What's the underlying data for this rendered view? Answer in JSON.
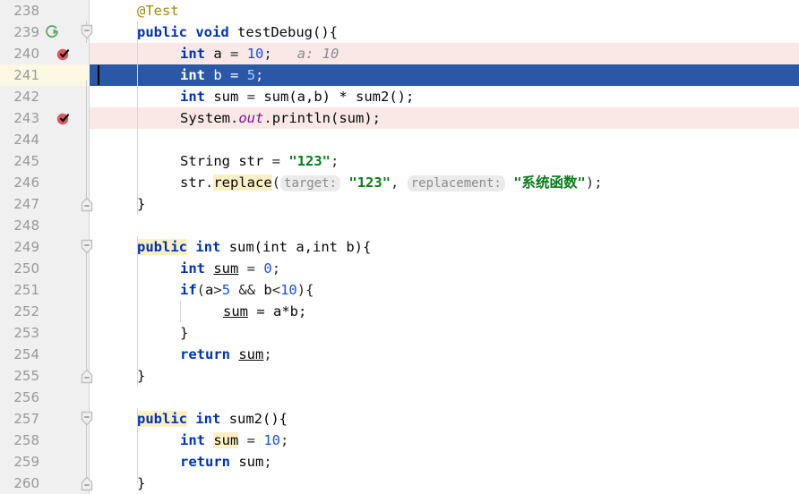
{
  "editor": {
    "app": "intellij-idea-code-editor",
    "language": "java",
    "first_line": 238,
    "last_line": 260,
    "line_height": 24,
    "caret_line": 241,
    "colors": {
      "background": "#ffffff",
      "gutter_background": "#f0f0f0",
      "line_number": "#999999",
      "selection": "#2a58a4",
      "breakpoint_line": "#f9e8e6",
      "caret_line_gutter": "#fcf8e3",
      "keyword": "#0033b3",
      "number": "#1750eb",
      "string": "#067d17",
      "annotation": "#9e880d",
      "static_field": "#871094",
      "identifier_highlight": "#fbefc4",
      "inline_hint": "#8c8c8c",
      "param_hint_background": "#ebebeb",
      "indent_guide": "#d8d8d8",
      "breakpoint_icon": "#db5860",
      "run_icon": "#59a869"
    },
    "gutter": {
      "line_numbers": [
        238,
        239,
        240,
        241,
        242,
        243,
        244,
        245,
        246,
        247,
        248,
        249,
        250,
        251,
        252,
        253,
        254,
        255,
        256,
        257,
        258,
        259,
        260
      ],
      "run_marker_line": 239,
      "breakpoint_lines": [
        240,
        243
      ],
      "fold_markers": [
        {
          "line": 239,
          "type": "fold-open-down"
        },
        {
          "line": 247,
          "type": "fold-close-up"
        },
        {
          "line": 249,
          "type": "fold-open-down"
        },
        {
          "line": 255,
          "type": "fold-close-up"
        },
        {
          "line": 257,
          "type": "fold-open-down"
        },
        {
          "line": 260,
          "type": "fold-close-up"
        }
      ]
    },
    "lines": [
      {
        "n": 238,
        "text": "    @Test"
      },
      {
        "n": 239,
        "text": "    public void testDebug(){"
      },
      {
        "n": 240,
        "text": "        int a = 10;   a: 10",
        "breakpoint": true
      },
      {
        "n": 241,
        "text": "        int b = 5;",
        "selected": true
      },
      {
        "n": 242,
        "text": "        int sum = sum(a,b) * sum2();"
      },
      {
        "n": 243,
        "text": "        System.out.println(sum);",
        "breakpoint": true
      },
      {
        "n": 244,
        "text": ""
      },
      {
        "n": 245,
        "text": "        String str = \"123\";"
      },
      {
        "n": 246,
        "text": "        str.replace( target: \"123\", replacement: \"系统函数\");"
      },
      {
        "n": 247,
        "text": "    }"
      },
      {
        "n": 248,
        "text": ""
      },
      {
        "n": 249,
        "text": "    public int sum(int a,int b){"
      },
      {
        "n": 250,
        "text": "        int sum = 0;"
      },
      {
        "n": 251,
        "text": "        if(a>5 && b<10){"
      },
      {
        "n": 252,
        "text": "            sum = a*b;"
      },
      {
        "n": 253,
        "text": "        }"
      },
      {
        "n": 254,
        "text": "        return sum;"
      },
      {
        "n": 255,
        "text": "    }"
      },
      {
        "n": 256,
        "text": ""
      },
      {
        "n": 257,
        "text": "    public int sum2(){"
      },
      {
        "n": 258,
        "text": "        int sum = 10;"
      },
      {
        "n": 259,
        "text": "        return sum;"
      },
      {
        "n": 260,
        "text": "    }"
      }
    ],
    "tokens": {
      "annotation_test": "@Test",
      "kw_public": "public",
      "kw_void": "void",
      "kw_int": "int",
      "kw_if": "if",
      "kw_return": "return",
      "method_testDebug": "testDebug(){",
      "var_a": "a",
      "var_b": "b",
      "var_sum": "sum",
      "num_10": "10",
      "num_5": "5",
      "num_0": "0",
      "literal_123": "\"123\"",
      "literal_cn": "\"系统函数\"",
      "system": "System",
      "out": "out",
      "println": "println(sum);",
      "string_type": "String",
      "var_str": "str",
      "method_replace": "replace",
      "hint_target": "target:",
      "hint_replacement": "replacement:",
      "inline_value_a": "a: 10",
      "expr_sum_call": "sum(a,b) * sum2();",
      "expr_cond": "(a>5 && b<10){",
      "expr_assign": "= a*b;",
      "brace_close": "}",
      "method_sum_sig": "sum(int a,int b){",
      "method_sum2_sig": "sum2(){"
    }
  }
}
